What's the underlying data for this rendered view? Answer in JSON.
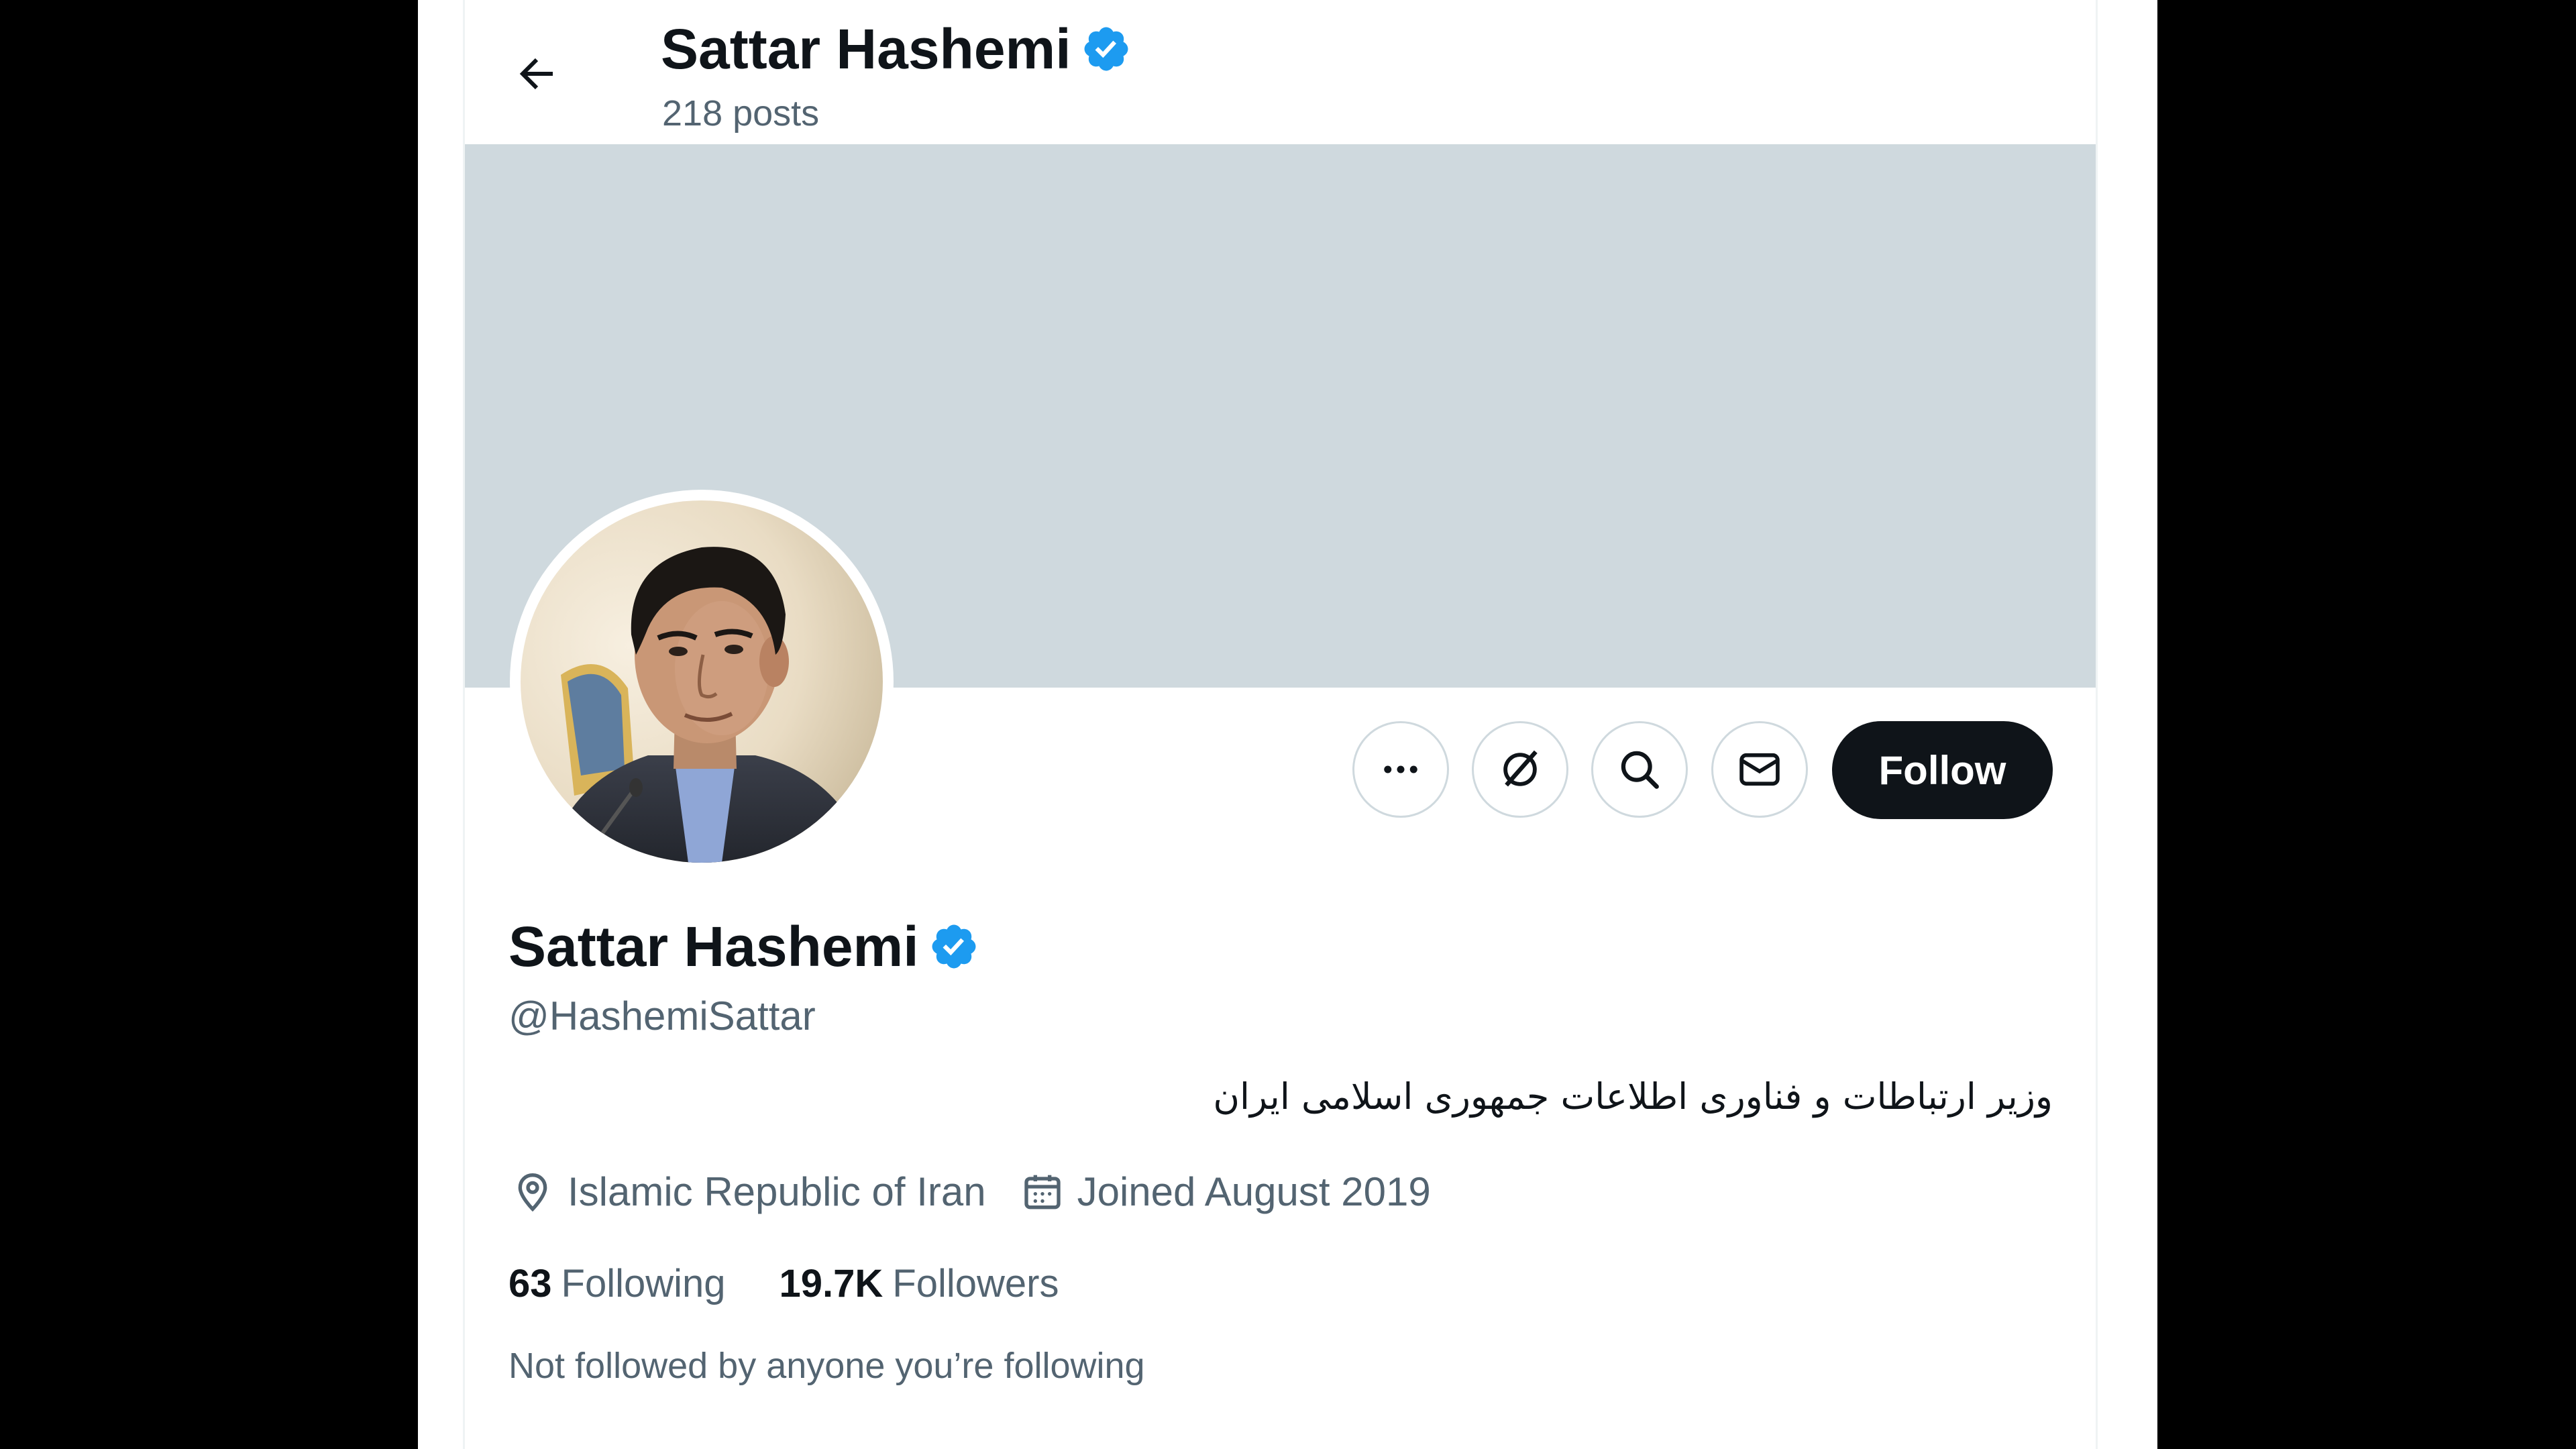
{
  "header": {
    "name": "Sattar Hashemi",
    "posts_count": "218 posts"
  },
  "icons": {
    "back": "arrow-left-icon",
    "verified": "verified-badge-icon",
    "more": "more-horizontal-icon",
    "grok": "grok-icon",
    "search": "search-icon",
    "message": "envelope-icon",
    "location": "location-pin-icon",
    "calendar": "calendar-icon"
  },
  "profile": {
    "display_name": "Sattar Hashemi",
    "handle": "@HashemiSattar",
    "bio": "وزیر ارتباطات و فناوری اطلاعات جمهوری اسلامی ایران",
    "location": "Islamic Republic of Iran",
    "joined": "Joined August 2019",
    "following_count": "63",
    "following_label": "Following",
    "followers_count": "19.7K",
    "followers_label": "Followers",
    "followed_by_note": "Not followed by anyone you’re following"
  },
  "actions": {
    "follow_label": "Follow"
  },
  "colors": {
    "accent_verified": "#1d9bf0",
    "banner": "#cfd9de",
    "secondary_text": "#536471",
    "follow_button_bg": "#0f1419"
  }
}
